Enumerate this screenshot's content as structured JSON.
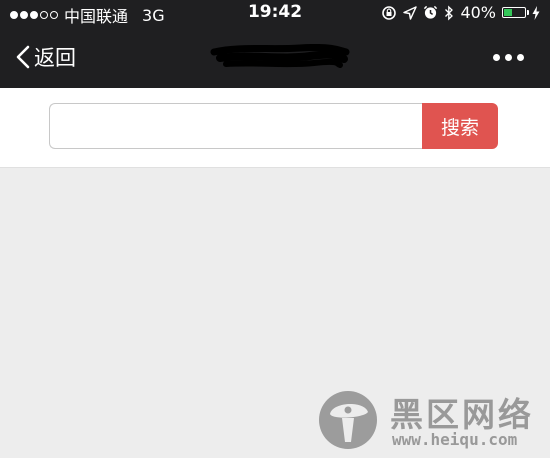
{
  "status_bar": {
    "signal_strength": 3,
    "carrier": "中国联通",
    "network": "3G",
    "time": "19:42",
    "battery_percent": "40%",
    "battery_level": 0.4,
    "battery_color": "#34c759",
    "icons": [
      "rotation-lock-icon",
      "location-arrow-icon",
      "alarm-icon",
      "bluetooth-icon",
      "battery-icon",
      "charging-bolt-icon"
    ]
  },
  "nav": {
    "back_label": "返回",
    "back_icon": "chevron-left-icon",
    "more_icon": "ellipsis-icon"
  },
  "search": {
    "value": "",
    "placeholder": "",
    "button_label": "搜索",
    "button_color": "#e05450"
  },
  "watermark": {
    "title": "黑区网络",
    "url": "www.heiqu.com"
  }
}
